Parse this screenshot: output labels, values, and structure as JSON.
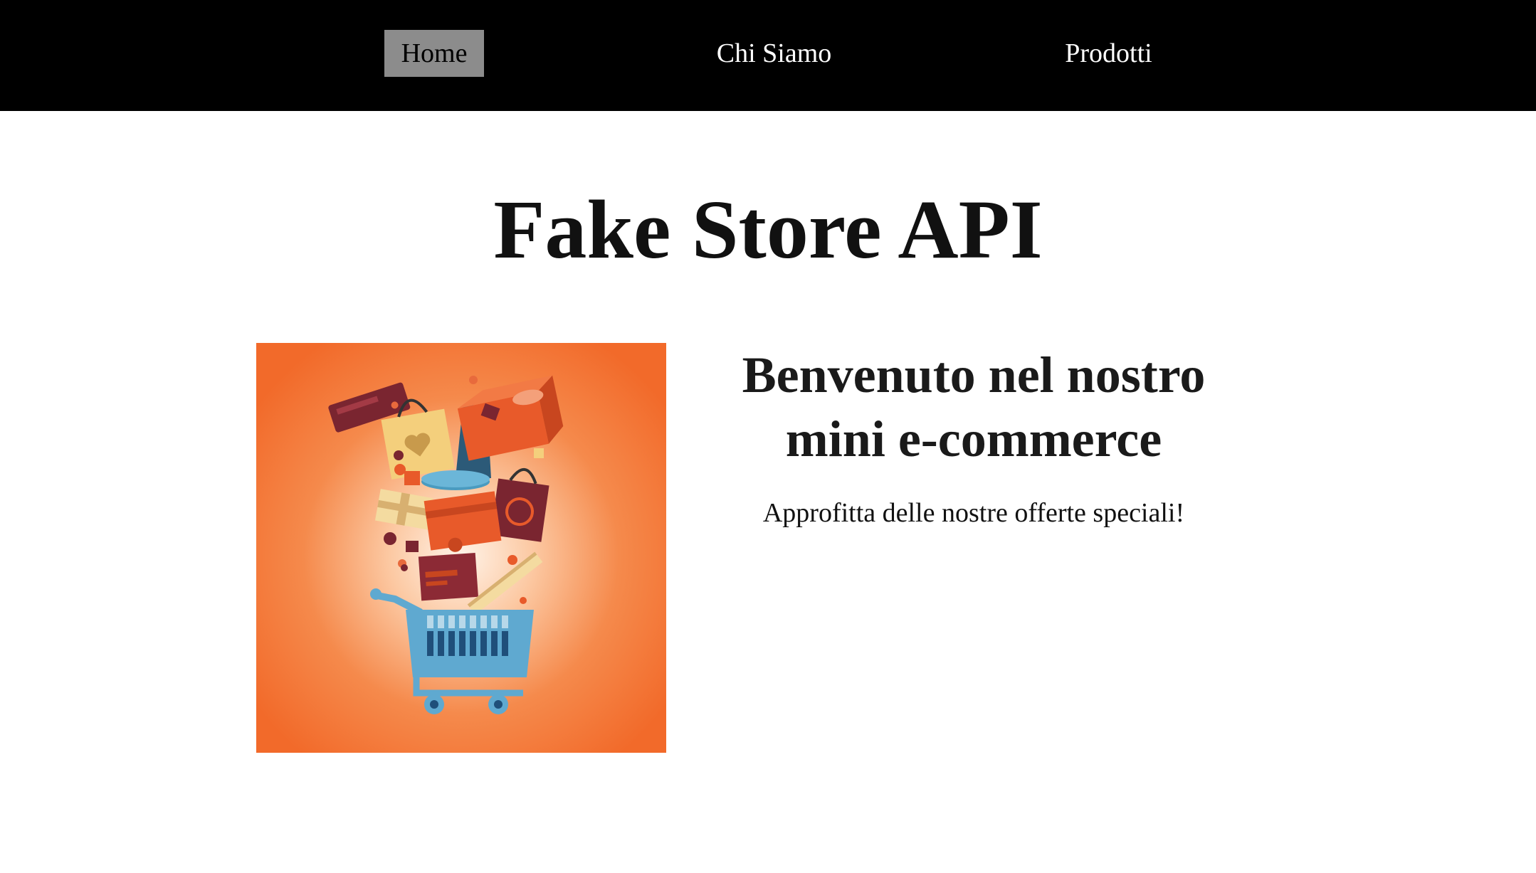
{
  "nav": {
    "items": [
      {
        "label": "Home",
        "active": true
      },
      {
        "label": "Chi Siamo",
        "active": false
      },
      {
        "label": "Prodotti",
        "active": false
      }
    ],
    "background": "#000000",
    "active_background": "#8c8c8c"
  },
  "main": {
    "title": "Fake Store API",
    "hero": {
      "image_icon": "shopping-cart-illustration",
      "background_color": "#f26a2a"
    },
    "welcome_heading": "Benvenuto nel nostro mini e-commerce",
    "offer_text": "Approfitta delle nostre offerte speciali!"
  }
}
